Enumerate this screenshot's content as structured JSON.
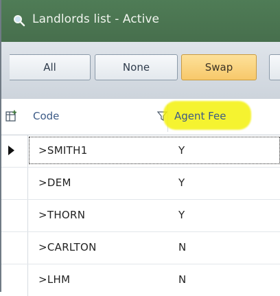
{
  "window": {
    "title": "Landlords list - Active",
    "title_icon": "search-icon",
    "accent_color": "#4f7c56"
  },
  "toolbar": {
    "buttons": [
      {
        "label": "All"
      },
      {
        "label": "None"
      },
      {
        "label": "Swap",
        "active": true,
        "color": "#f9d27c"
      }
    ]
  },
  "grid": {
    "columns": [
      {
        "label": "Code",
        "filter_icon": "filter-icon"
      },
      {
        "label": "Agent Fee",
        "highlight_color": "#f4f10c"
      }
    ],
    "rows": [
      {
        "code": ">SMITH1",
        "agent_fee": "Y",
        "selected": true
      },
      {
        "code": ">DEM",
        "agent_fee": "Y"
      },
      {
        "code": ">THORN",
        "agent_fee": "Y"
      },
      {
        "code": ">CARLTON",
        "agent_fee": "N"
      },
      {
        "code": ">LHM",
        "agent_fee": "N"
      }
    ]
  }
}
